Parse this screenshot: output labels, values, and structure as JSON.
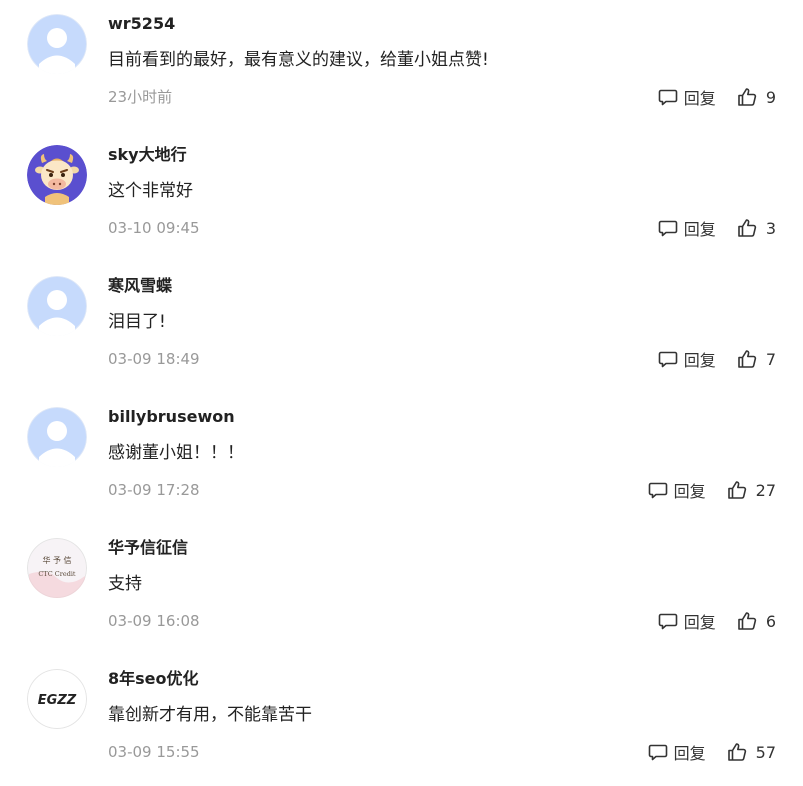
{
  "comments": [
    {
      "username": "wr5254",
      "content": "目前看到的最好，最有意义的建议，给董小姐点赞!",
      "time": "23小时前",
      "reply_label": "回复",
      "likes": "9",
      "avatar": "default-avatar-icon"
    },
    {
      "username": "sky大地行",
      "content": "这个非常好",
      "time": "03-10 09:45",
      "reply_label": "回复",
      "likes": "3",
      "avatar": "cow-avatar"
    },
    {
      "username": "寒风雪蝶",
      "content": "泪目了!",
      "time": "03-09 18:49",
      "reply_label": "回复",
      "likes": "7",
      "avatar": "default-avatar-icon"
    },
    {
      "username": "billybrusewon",
      "content": "感谢董小姐！！！",
      "time": "03-09 17:28",
      "reply_label": "回复",
      "likes": "27",
      "avatar": "default-avatar-icon"
    },
    {
      "username": "华予信征信",
      "content": "支持",
      "time": "03-09 16:08",
      "reply_label": "回复",
      "likes": "6",
      "avatar": "ctc-credit-logo",
      "avatar_text": "CTC Credit"
    },
    {
      "username": "8年seo优化",
      "content": "靠创新才有用，不能靠苦干",
      "time": "03-09 15:55",
      "reply_label": "回复",
      "likes": "57",
      "avatar": "ezz-logo",
      "avatar_text": "EGZZ"
    }
  ],
  "colors": {
    "default_avatar_bg": "#c6dafc",
    "default_avatar_fg": "#ffffff",
    "cow_avatar_bg": "#5a4fcf",
    "text_primary": "#222222",
    "text_muted": "#999999"
  }
}
